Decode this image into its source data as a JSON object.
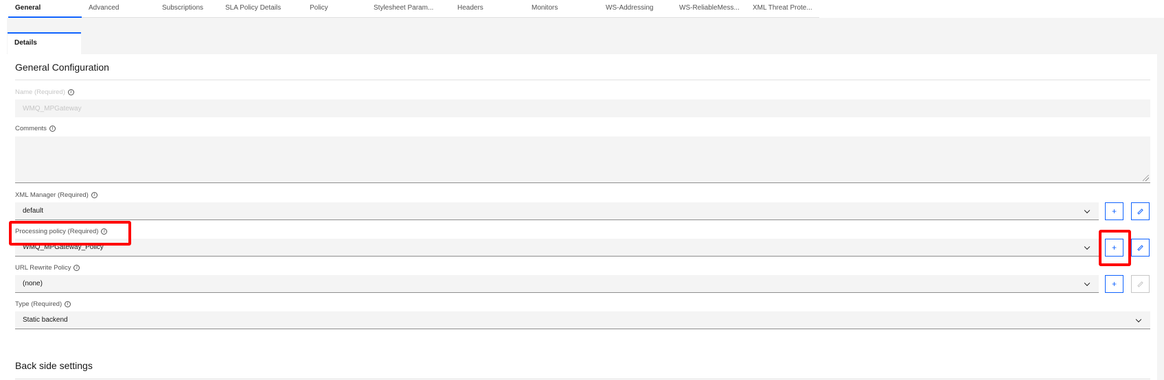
{
  "tabs": [
    {
      "label": "General",
      "active": true
    },
    {
      "label": "Advanced"
    },
    {
      "label": "Subscriptions"
    },
    {
      "label": "SLA Policy Details"
    },
    {
      "label": "Policy"
    },
    {
      "label": "Stylesheet Param..."
    },
    {
      "label": "Headers"
    },
    {
      "label": "Monitors"
    },
    {
      "label": "WS-Addressing"
    },
    {
      "label": "WS-ReliableMess..."
    },
    {
      "label": "XML Threat Prote..."
    }
  ],
  "subtab": {
    "label": "Details"
  },
  "general": {
    "title": "General Configuration",
    "name": {
      "label": "Name (Required)",
      "value": "WMQ_MPGateway",
      "disabled": true
    },
    "comments": {
      "label": "Comments",
      "value": ""
    },
    "xml_manager": {
      "label": "XML Manager (Required)",
      "value": "default"
    },
    "processing_policy": {
      "label": "Processing policy (Required)",
      "value": "WMQ_MPGateway_Policy"
    },
    "url_rewrite": {
      "label": "URL Rewrite Policy",
      "value": "(none)"
    },
    "type": {
      "label": "Type (Required)",
      "value": "Static backend"
    },
    "add_symbol": "+"
  },
  "backside": {
    "title": "Back side settings"
  },
  "colors": {
    "accent": "#0f62fe",
    "highlight": "#ff0000",
    "field_bg": "#f4f4f4"
  }
}
